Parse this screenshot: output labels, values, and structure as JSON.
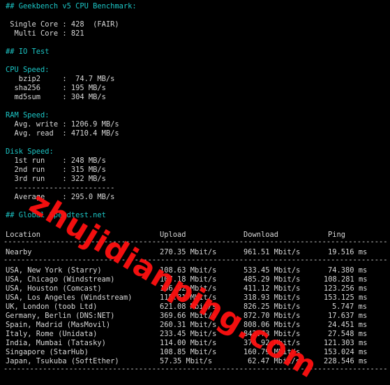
{
  "geekbench": {
    "header": "## Geekbench v5 CPU Benchmark:",
    "single_core": " Single Core : 428  (FAIR)",
    "multi_core": "  Multi Core : 821"
  },
  "io_test": {
    "header": "## IO Test",
    "cpu_speed": {
      "title": "CPU Speed:",
      "rows": [
        "   bzip2     :  74.7 MB/s",
        "  sha256     : 195 MB/s",
        "  md5sum     : 304 MB/s"
      ]
    },
    "ram_speed": {
      "title": "RAM Speed:",
      "rows": [
        "  Avg. write : 1206.9 MB/s",
        "  Avg. read  : 4710.4 MB/s"
      ]
    },
    "disk_speed": {
      "title": "Disk Speed:",
      "rows": [
        "  1st run    : 248 MB/s",
        "  2nd run    : 315 MB/s",
        "  3rd run    : 322 MB/s",
        "  -----------------------",
        "  Average    : 295.0 MB/s"
      ]
    }
  },
  "speedtest": {
    "header": "## Global Speedtest.net",
    "columns": {
      "location": "Location",
      "upload": "Upload",
      "download": "Download",
      "ping": "Ping"
    },
    "separator": "-------------------------------------------------------------------------------------------",
    "nearby": {
      "location": "Nearby",
      "upload": "270.35 Mbit/s",
      "download": "961.51 Mbit/s",
      "ping": "19.516 ms"
    },
    "rows": [
      {
        "location": "USA, New York (Starry)",
        "upload": "108.63 Mbit/s",
        "download": "533.45 Mbit/s",
        "ping": "74.380 ms"
      },
      {
        "location": "USA, Chicago (Windstream)",
        "upload": "107.18 Mbit/s",
        "download": "485.29 Mbit/s",
        "ping": "108.281 ms"
      },
      {
        "location": "USA, Houston (Comcast)",
        "upload": "106.82 Mbit/s",
        "download": "411.12 Mbit/s",
        "ping": "123.256 ms"
      },
      {
        "location": "USA, Los Angeles (Windstream)",
        "upload": "115.81 Mbit/s",
        "download": "318.93 Mbit/s",
        "ping": "153.125 ms"
      },
      {
        "location": "UK, London (toob Ltd)",
        "upload": "621.08 Mbit/s",
        "download": "826.25 Mbit/s",
        "ping": "5.747 ms"
      },
      {
        "location": "Germany, Berlin (DNS:NET)",
        "upload": "369.66 Mbit/s",
        "download": "872.70 Mbit/s",
        "ping": "17.637 ms"
      },
      {
        "location": "Spain, Madrid (MasMovil)",
        "upload": "260.31 Mbit/s",
        "download": "808.06 Mbit/s",
        "ping": "24.451 ms"
      },
      {
        "location": "Italy, Rome (Unidata)",
        "upload": "233.45 Mbit/s",
        "download": "842.73 Mbit/s",
        "ping": "27.548 ms"
      },
      {
        "location": "India, Mumbai (Tatasky)",
        "upload": "114.00 Mbit/s",
        "download": "379.92 Mbit/s",
        "ping": "121.303 ms"
      },
      {
        "location": "Singapore (StarHub)",
        "upload": "108.85 Mbit/s",
        "download": "160.79 Mbit/s",
        "ping": "153.024 ms"
      },
      {
        "location": "Japan, Tsukuba (SoftEther)",
        "upload": "57.35 Mbit/s",
        "download": "62.47 Mbit/s",
        "ping": "228.546 ms"
      }
    ]
  },
  "watermark": "zhujidianping.com",
  "colors": {
    "background": "#000000",
    "text": "#d8d8d8",
    "heading": "#1cc6c6",
    "watermark": "#ff1010"
  }
}
